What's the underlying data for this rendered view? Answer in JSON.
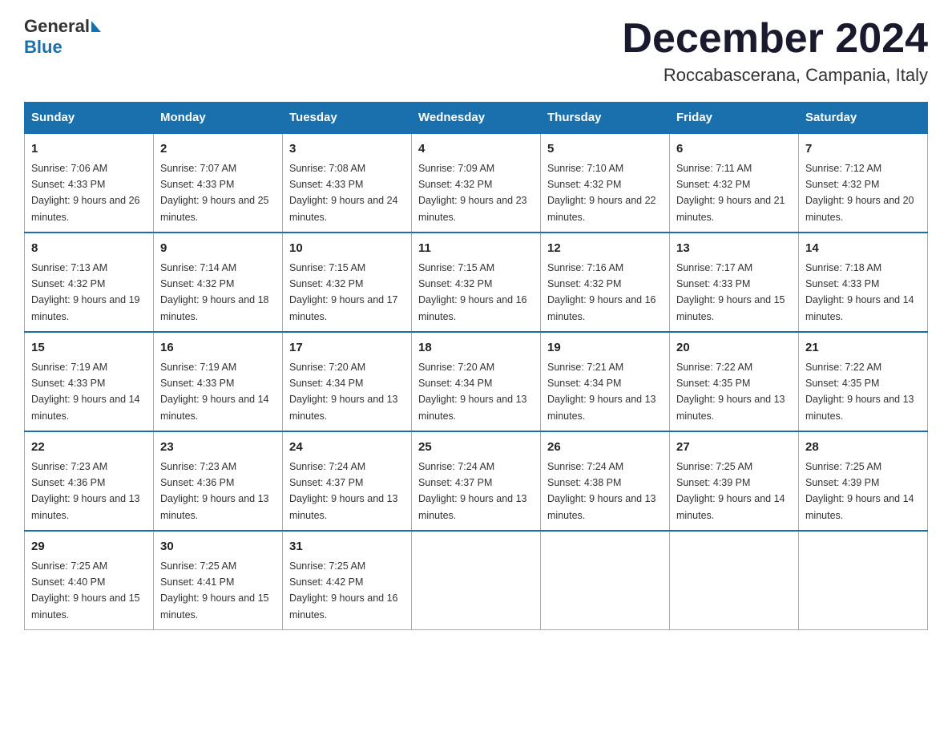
{
  "header": {
    "logo_general": "General",
    "logo_blue": "Blue",
    "month_title": "December 2024",
    "location": "Roccabascerana, Campania, Italy"
  },
  "weekdays": [
    "Sunday",
    "Monday",
    "Tuesday",
    "Wednesday",
    "Thursday",
    "Friday",
    "Saturday"
  ],
  "weeks": [
    [
      {
        "day": "1",
        "sunrise": "Sunrise: 7:06 AM",
        "sunset": "Sunset: 4:33 PM",
        "daylight": "Daylight: 9 hours and 26 minutes."
      },
      {
        "day": "2",
        "sunrise": "Sunrise: 7:07 AM",
        "sunset": "Sunset: 4:33 PM",
        "daylight": "Daylight: 9 hours and 25 minutes."
      },
      {
        "day": "3",
        "sunrise": "Sunrise: 7:08 AM",
        "sunset": "Sunset: 4:33 PM",
        "daylight": "Daylight: 9 hours and 24 minutes."
      },
      {
        "day": "4",
        "sunrise": "Sunrise: 7:09 AM",
        "sunset": "Sunset: 4:32 PM",
        "daylight": "Daylight: 9 hours and 23 minutes."
      },
      {
        "day": "5",
        "sunrise": "Sunrise: 7:10 AM",
        "sunset": "Sunset: 4:32 PM",
        "daylight": "Daylight: 9 hours and 22 minutes."
      },
      {
        "day": "6",
        "sunrise": "Sunrise: 7:11 AM",
        "sunset": "Sunset: 4:32 PM",
        "daylight": "Daylight: 9 hours and 21 minutes."
      },
      {
        "day": "7",
        "sunrise": "Sunrise: 7:12 AM",
        "sunset": "Sunset: 4:32 PM",
        "daylight": "Daylight: 9 hours and 20 minutes."
      }
    ],
    [
      {
        "day": "8",
        "sunrise": "Sunrise: 7:13 AM",
        "sunset": "Sunset: 4:32 PM",
        "daylight": "Daylight: 9 hours and 19 minutes."
      },
      {
        "day": "9",
        "sunrise": "Sunrise: 7:14 AM",
        "sunset": "Sunset: 4:32 PM",
        "daylight": "Daylight: 9 hours and 18 minutes."
      },
      {
        "day": "10",
        "sunrise": "Sunrise: 7:15 AM",
        "sunset": "Sunset: 4:32 PM",
        "daylight": "Daylight: 9 hours and 17 minutes."
      },
      {
        "day": "11",
        "sunrise": "Sunrise: 7:15 AM",
        "sunset": "Sunset: 4:32 PM",
        "daylight": "Daylight: 9 hours and 16 minutes."
      },
      {
        "day": "12",
        "sunrise": "Sunrise: 7:16 AM",
        "sunset": "Sunset: 4:32 PM",
        "daylight": "Daylight: 9 hours and 16 minutes."
      },
      {
        "day": "13",
        "sunrise": "Sunrise: 7:17 AM",
        "sunset": "Sunset: 4:33 PM",
        "daylight": "Daylight: 9 hours and 15 minutes."
      },
      {
        "day": "14",
        "sunrise": "Sunrise: 7:18 AM",
        "sunset": "Sunset: 4:33 PM",
        "daylight": "Daylight: 9 hours and 14 minutes."
      }
    ],
    [
      {
        "day": "15",
        "sunrise": "Sunrise: 7:19 AM",
        "sunset": "Sunset: 4:33 PM",
        "daylight": "Daylight: 9 hours and 14 minutes."
      },
      {
        "day": "16",
        "sunrise": "Sunrise: 7:19 AM",
        "sunset": "Sunset: 4:33 PM",
        "daylight": "Daylight: 9 hours and 14 minutes."
      },
      {
        "day": "17",
        "sunrise": "Sunrise: 7:20 AM",
        "sunset": "Sunset: 4:34 PM",
        "daylight": "Daylight: 9 hours and 13 minutes."
      },
      {
        "day": "18",
        "sunrise": "Sunrise: 7:20 AM",
        "sunset": "Sunset: 4:34 PM",
        "daylight": "Daylight: 9 hours and 13 minutes."
      },
      {
        "day": "19",
        "sunrise": "Sunrise: 7:21 AM",
        "sunset": "Sunset: 4:34 PM",
        "daylight": "Daylight: 9 hours and 13 minutes."
      },
      {
        "day": "20",
        "sunrise": "Sunrise: 7:22 AM",
        "sunset": "Sunset: 4:35 PM",
        "daylight": "Daylight: 9 hours and 13 minutes."
      },
      {
        "day": "21",
        "sunrise": "Sunrise: 7:22 AM",
        "sunset": "Sunset: 4:35 PM",
        "daylight": "Daylight: 9 hours and 13 minutes."
      }
    ],
    [
      {
        "day": "22",
        "sunrise": "Sunrise: 7:23 AM",
        "sunset": "Sunset: 4:36 PM",
        "daylight": "Daylight: 9 hours and 13 minutes."
      },
      {
        "day": "23",
        "sunrise": "Sunrise: 7:23 AM",
        "sunset": "Sunset: 4:36 PM",
        "daylight": "Daylight: 9 hours and 13 minutes."
      },
      {
        "day": "24",
        "sunrise": "Sunrise: 7:24 AM",
        "sunset": "Sunset: 4:37 PM",
        "daylight": "Daylight: 9 hours and 13 minutes."
      },
      {
        "day": "25",
        "sunrise": "Sunrise: 7:24 AM",
        "sunset": "Sunset: 4:37 PM",
        "daylight": "Daylight: 9 hours and 13 minutes."
      },
      {
        "day": "26",
        "sunrise": "Sunrise: 7:24 AM",
        "sunset": "Sunset: 4:38 PM",
        "daylight": "Daylight: 9 hours and 13 minutes."
      },
      {
        "day": "27",
        "sunrise": "Sunrise: 7:25 AM",
        "sunset": "Sunset: 4:39 PM",
        "daylight": "Daylight: 9 hours and 14 minutes."
      },
      {
        "day": "28",
        "sunrise": "Sunrise: 7:25 AM",
        "sunset": "Sunset: 4:39 PM",
        "daylight": "Daylight: 9 hours and 14 minutes."
      }
    ],
    [
      {
        "day": "29",
        "sunrise": "Sunrise: 7:25 AM",
        "sunset": "Sunset: 4:40 PM",
        "daylight": "Daylight: 9 hours and 15 minutes."
      },
      {
        "day": "30",
        "sunrise": "Sunrise: 7:25 AM",
        "sunset": "Sunset: 4:41 PM",
        "daylight": "Daylight: 9 hours and 15 minutes."
      },
      {
        "day": "31",
        "sunrise": "Sunrise: 7:25 AM",
        "sunset": "Sunset: 4:42 PM",
        "daylight": "Daylight: 9 hours and 16 minutes."
      },
      null,
      null,
      null,
      null
    ]
  ]
}
